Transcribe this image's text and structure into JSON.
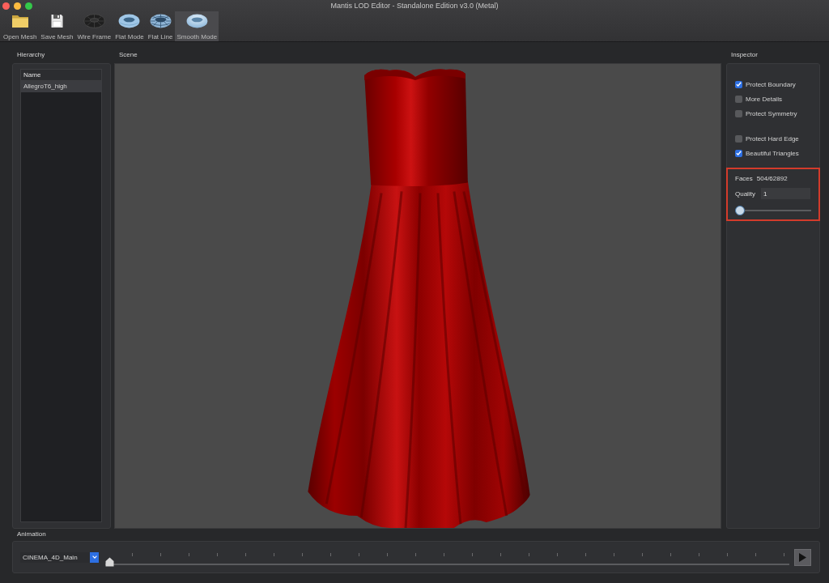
{
  "window": {
    "title": "Mantis LOD Editor - Standalone Edition v3.0 (Metal)"
  },
  "toolbar": [
    {
      "label": "Open Mesh",
      "kind": "folder",
      "selected": false
    },
    {
      "label": "Save Mesh",
      "kind": "disk",
      "selected": false
    },
    {
      "label": "Wire Frame",
      "kind": "wireframe",
      "selected": false
    },
    {
      "label": "Flat Mode",
      "kind": "flat",
      "selected": false
    },
    {
      "label": "Flat Line",
      "kind": "flatline",
      "selected": false
    },
    {
      "label": "Smooth Mode",
      "kind": "smooth",
      "selected": true
    }
  ],
  "hierarchy": {
    "title": "Hierarchy",
    "column": "Name",
    "items": [
      {
        "label": "AllegroT6_high",
        "selected": true
      }
    ]
  },
  "scene": {
    "title": "Scene"
  },
  "inspector": {
    "title": "Inspector",
    "option_groups": [
      [
        {
          "label": "Protect Boundary",
          "checked": true
        },
        {
          "label": "More Details",
          "checked": false
        },
        {
          "label": "Protect Symmetry",
          "checked": false
        }
      ],
      [
        {
          "label": "Protect Hard Edge",
          "checked": false
        },
        {
          "label": "Beautiful Triangles",
          "checked": true
        }
      ]
    ],
    "faces_label": "Faces",
    "faces_value": "504/62892",
    "quality_label": "Quality",
    "quality_value": "1",
    "quality_slider": {
      "level": 0
    }
  },
  "animation": {
    "title": "Animation",
    "clip": "CINEMA_4D_Main",
    "timeline": {
      "level": 0
    }
  }
}
